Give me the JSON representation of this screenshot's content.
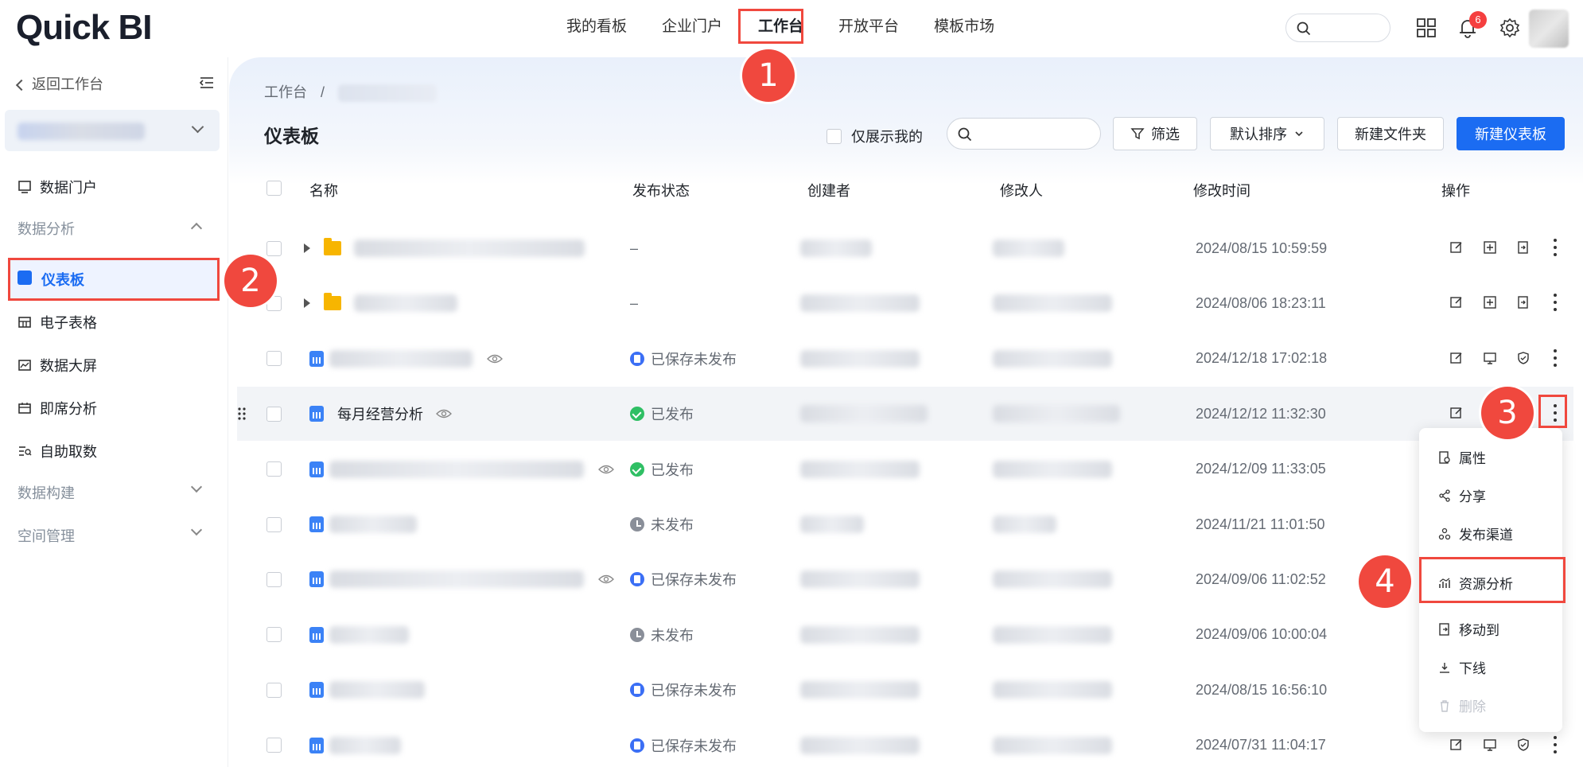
{
  "app": {
    "logo": "Quick BI"
  },
  "topnav": {
    "items": [
      {
        "label": "我的看板"
      },
      {
        "label": "企业门户"
      },
      {
        "label": "工作台"
      },
      {
        "label": "开放平台"
      },
      {
        "label": "模板市场"
      }
    ],
    "active_index": 2,
    "notification_count": "6"
  },
  "sidebar": {
    "back_label": "返回工作台",
    "items": [
      {
        "label": "数据门户",
        "icon": "monitor-icon"
      },
      {
        "label": "数据分析",
        "group": true,
        "expanded": true
      },
      {
        "label": "仪表板",
        "icon": "dashboard-icon",
        "active": true
      },
      {
        "label": "电子表格",
        "icon": "table-icon"
      },
      {
        "label": "数据大屏",
        "icon": "line-chart-icon"
      },
      {
        "label": "即席分析",
        "icon": "calendar-icon"
      },
      {
        "label": "自助取数",
        "icon": "search-list-icon"
      },
      {
        "label": "数据构建",
        "group": true,
        "expanded": false
      },
      {
        "label": "空间管理",
        "group": true,
        "expanded": false
      }
    ]
  },
  "breadcrumb": {
    "root": "工作台",
    "separator": "/"
  },
  "page": {
    "title": "仪表板",
    "only_mine_label": "仅展示我的",
    "filter_label": "筛选",
    "sort_label": "默认排序",
    "new_folder_label": "新建文件夹",
    "new_dashboard_label": "新建仪表板"
  },
  "table": {
    "headers": {
      "name": "名称",
      "status": "发布状态",
      "creator": "创建者",
      "modifier": "修改人",
      "modified_time": "修改时间",
      "actions": "操作"
    },
    "rows": [
      {
        "type": "folder",
        "name": "",
        "status": "–",
        "status_kind": "none",
        "time": "2024/08/15 10:59:59"
      },
      {
        "type": "folder",
        "name": "",
        "status": "–",
        "status_kind": "none",
        "time": "2024/08/06 18:23:11"
      },
      {
        "type": "dashboard",
        "name": "",
        "status": "已保存未发布",
        "status_kind": "saved",
        "time": "2024/12/18 17:02:18"
      },
      {
        "type": "dashboard",
        "name": "每月经营分析",
        "status": "已发布",
        "status_kind": "published",
        "time": "2024/12/12 11:32:30"
      },
      {
        "type": "dashboard",
        "name": "",
        "status": "已发布",
        "status_kind": "published",
        "time": "2024/12/09 11:33:05"
      },
      {
        "type": "dashboard",
        "name": "",
        "status": "未发布",
        "status_kind": "unpublished",
        "time": "2024/11/21 11:01:50"
      },
      {
        "type": "dashboard",
        "name": "",
        "status": "已保存未发布",
        "status_kind": "saved",
        "time": "2024/09/06 11:02:52"
      },
      {
        "type": "dashboard",
        "name": "",
        "status": "未发布",
        "status_kind": "unpublished",
        "time": "2024/09/06 10:00:04"
      },
      {
        "type": "dashboard",
        "name": "",
        "status": "已保存未发布",
        "status_kind": "saved",
        "time": "2024/08/15 16:56:10"
      },
      {
        "type": "dashboard",
        "name": "",
        "status": "已保存未发布",
        "status_kind": "saved",
        "time": "2024/07/31 11:04:17"
      }
    ]
  },
  "context_menu": {
    "items": [
      {
        "label": "属性",
        "icon": "properties-icon"
      },
      {
        "label": "分享",
        "icon": "share-icon"
      },
      {
        "label": "发布渠道",
        "icon": "channel-icon"
      },
      {
        "label": "资源分析",
        "icon": "resource-analysis-icon"
      },
      {
        "label": "移动到",
        "icon": "move-icon"
      },
      {
        "label": "下线",
        "icon": "offline-icon"
      },
      {
        "label": "删除",
        "icon": "trash-icon",
        "disabled": true
      }
    ]
  },
  "annotations": {
    "markers": [
      "1",
      "2",
      "3",
      "4"
    ],
    "color": "#f0483e"
  },
  "colors": {
    "primary": "#1b6cf2",
    "published": "#2fbf64",
    "saved": "#3b6ff5",
    "unpublished": "#8a8f99"
  }
}
